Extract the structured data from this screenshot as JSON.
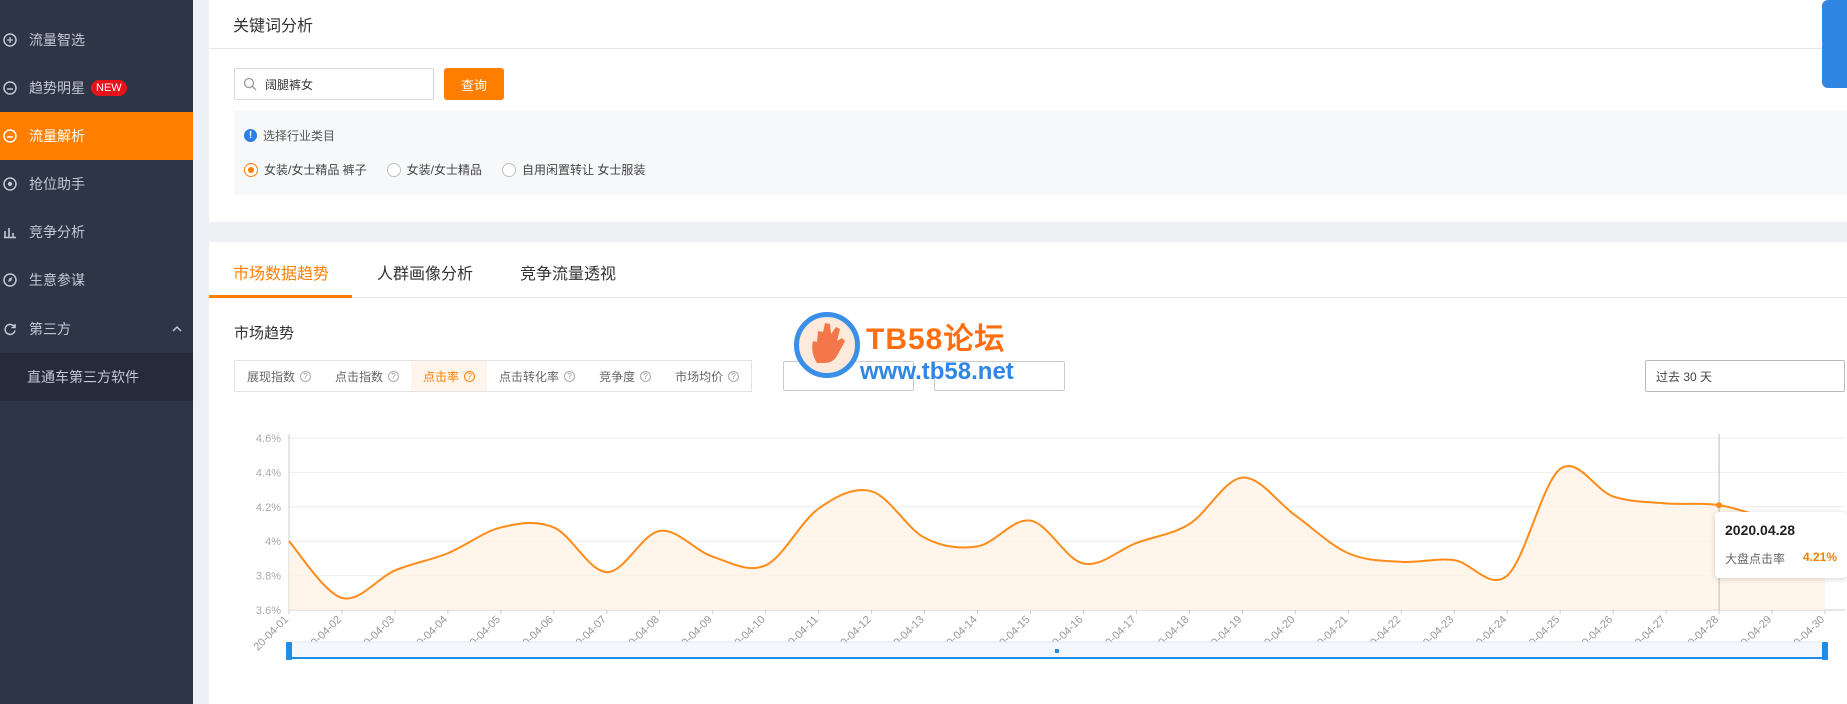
{
  "sidebar": {
    "items": [
      {
        "label": "流量智选",
        "icon": "compass-icon",
        "active": false
      },
      {
        "label": "趋势明星",
        "icon": "trend-star-icon",
        "badge": "NEW",
        "active": false
      },
      {
        "label": "流量解析",
        "icon": "traffic-analysis-icon",
        "active": true
      },
      {
        "label": "抢位助手",
        "icon": "target-icon",
        "active": false
      },
      {
        "label": "竞争分析",
        "icon": "bar-chart-icon",
        "active": false
      },
      {
        "label": "生意参谋",
        "icon": "compass-needle-icon",
        "active": false
      },
      {
        "label": "第三方",
        "icon": "refresh-icon",
        "expandable": true,
        "active": false
      }
    ],
    "sub_item": "直通车第三方软件"
  },
  "keyword": {
    "title": "关键词分析",
    "search_value": "阔腿裤女",
    "search_button": "查询",
    "category_prompt": "选择行业类目",
    "categories": [
      {
        "label": "女装/女士精品 裤子",
        "checked": true
      },
      {
        "label": "女装/女士精品",
        "checked": false
      },
      {
        "label": "自用闲置转让 女士服装",
        "checked": false
      }
    ]
  },
  "tabs": [
    "市场数据趋势",
    "人群画像分析",
    "竞争流量透视"
  ],
  "market": {
    "title": "市场趋势",
    "metrics": [
      {
        "label": "展现指数",
        "active": false
      },
      {
        "label": "点击指数",
        "active": false
      },
      {
        "label": "点击率",
        "active": true
      },
      {
        "label": "点击转化率",
        "active": false
      },
      {
        "label": "竞争度",
        "active": false
      },
      {
        "label": "市场均价",
        "active": false
      }
    ],
    "date_range": "过去 30 天"
  },
  "watermark": {
    "title": "TB58论坛",
    "url": "www.tb58.net"
  },
  "tooltip": {
    "date": "2020.04.28",
    "label": "大盘点击率",
    "value": "4.21%"
  },
  "colors": {
    "accent": "#ff7e00",
    "sidebar_bg": "#2e3547",
    "line": "#ff8c1a",
    "slider": "#1f8ce6"
  },
  "chart_data": {
    "type": "area",
    "x": [
      "20-04-01",
      "20-04-02",
      "20-04-03",
      "20-04-04",
      "20-04-05",
      "20-04-06",
      "20-04-07",
      "20-04-08",
      "20-04-09",
      "20-04-10",
      "20-04-11",
      "20-04-12",
      "20-04-13",
      "20-04-14",
      "20-04-15",
      "20-04-16",
      "20-04-17",
      "20-04-18",
      "20-04-19",
      "20-04-20",
      "20-04-21",
      "20-04-22",
      "20-04-23",
      "20-04-24",
      "20-04-25",
      "20-04-26",
      "20-04-27",
      "20-04-28",
      "20-04-29",
      "20-04-30"
    ],
    "series": [
      {
        "values": [
          4.0,
          3.67,
          3.83,
          3.93,
          4.08,
          4.08,
          3.82,
          4.06,
          3.91,
          3.86,
          4.19,
          4.29,
          4.02,
          3.97,
          4.12,
          3.87,
          3.99,
          4.1,
          4.37,
          4.15,
          3.93,
          3.88,
          3.89,
          3.8,
          4.42,
          4.26,
          4.22,
          4.21,
          4.13,
          4.1
        ]
      }
    ],
    "ylim": [
      3.6,
      4.6
    ],
    "yticks": [
      "3.6%",
      "3.8%",
      "4%",
      "4.2%",
      "4.4%",
      "4.6%"
    ],
    "grid": true
  }
}
